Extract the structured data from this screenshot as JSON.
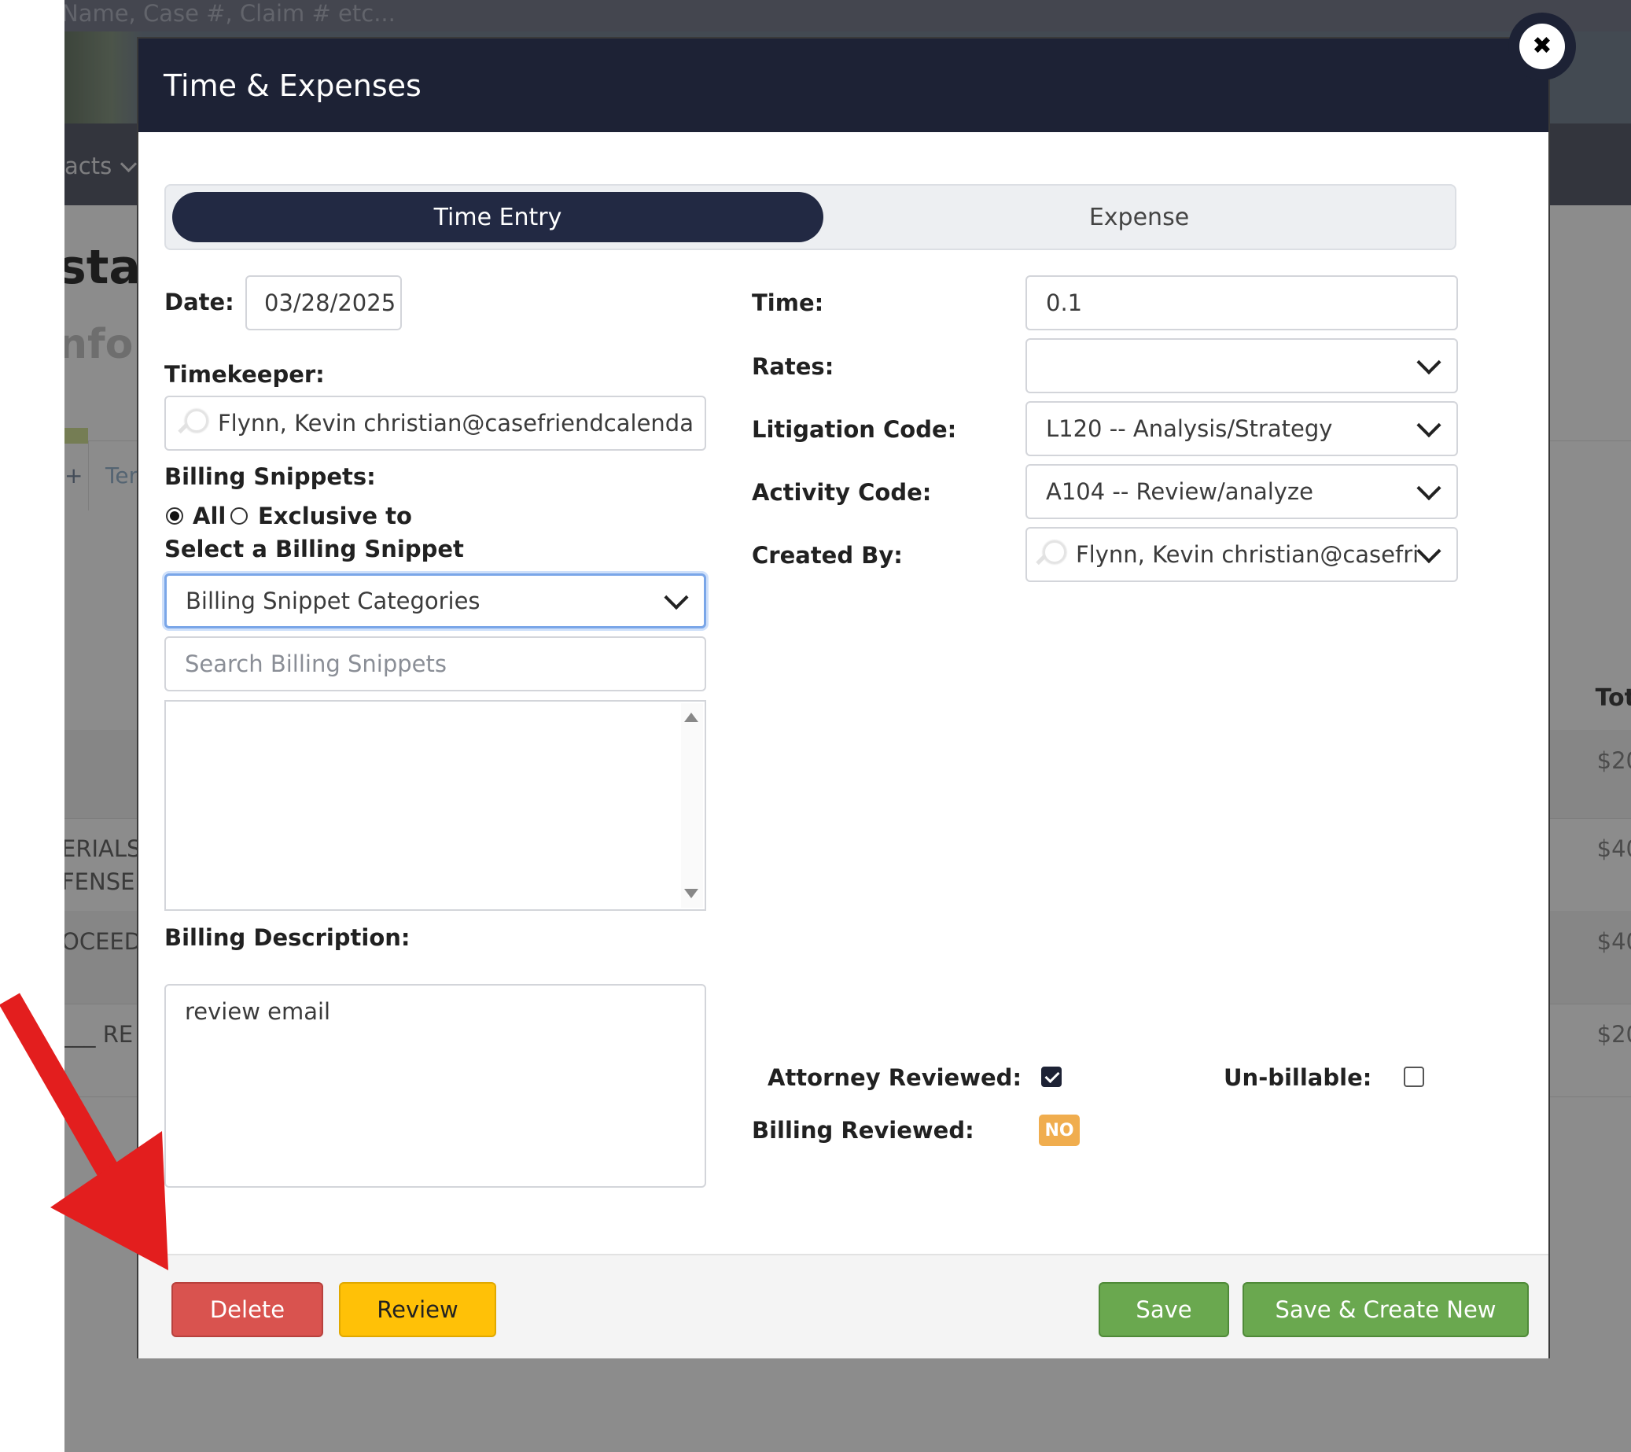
{
  "background": {
    "search_placeholder": "Name, Case #, Claim # etc...",
    "nav_item": "acts",
    "heading_fragment": "sta",
    "subheading_fragment": "nfo",
    "tab_fragment": "Ter",
    "tab_mark": "+",
    "total_header_fragment": "Tot",
    "rows": [
      {
        "text": "",
        "amount": "$20"
      },
      {
        "text": "ERIALS\nFENSE",
        "amount": "$40"
      },
      {
        "text": "OCEED",
        "amount": "$40"
      },
      {
        "text": "___ RE",
        "amount": "$20"
      }
    ]
  },
  "modal": {
    "title": "Time & Expenses",
    "close_symbol": "✖",
    "tabs": {
      "active": "Time Entry",
      "inactive": "Expense"
    },
    "left": {
      "date_label": "Date:",
      "date_value": "03/28/2025",
      "timekeeper_label": "Timekeeper:",
      "timekeeper_value": "Flynn, Kevin  christian@casefriendcalenda",
      "billing_snippets_label": "Billing Snippets:",
      "radio_all_label": "All",
      "radio_exclusive_label": "Exclusive to",
      "select_snippet_label": "Select a Billing Snippet",
      "snippet_categories_value": "Billing Snippet Categories",
      "snippet_search_placeholder": "Search Billing Snippets",
      "billing_description_label": "Billing Description:",
      "billing_description_value": "review email"
    },
    "right": {
      "time_label": "Time:",
      "time_value": "0.1",
      "rates_label": "Rates:",
      "rates_value": "",
      "litigation_code_label": "Litigation Code:",
      "litigation_code_value": "L120 -- Analysis/Strategy",
      "activity_code_label": "Activity Code:",
      "activity_code_value": "A104 -- Review/analyze",
      "created_by_label": "Created By:",
      "created_by_value": "Flynn, Kevin  christian@casefri",
      "attorney_reviewed_label": "Attorney Reviewed:",
      "attorney_reviewed": true,
      "unbillable_label": "Un-billable:",
      "unbillable": false,
      "billing_reviewed_label": "Billing Reviewed:",
      "billing_reviewed_badge": "NO"
    },
    "footer": {
      "delete_label": "Delete",
      "review_label": "Review",
      "save_label": "Save",
      "save_new_label": "Save & Create New"
    }
  },
  "colors": {
    "header_bg": "#1d2235",
    "delete": "#d9534f",
    "review": "#ffc107",
    "save": "#6aa84f",
    "badge_no": "#f0ad4e",
    "annotation_arrow": "#e31e1e"
  },
  "icons": [
    "close-icon",
    "search-icon",
    "chevron-down-icon",
    "checkbox-icon",
    "red-arrow-annotation"
  ]
}
